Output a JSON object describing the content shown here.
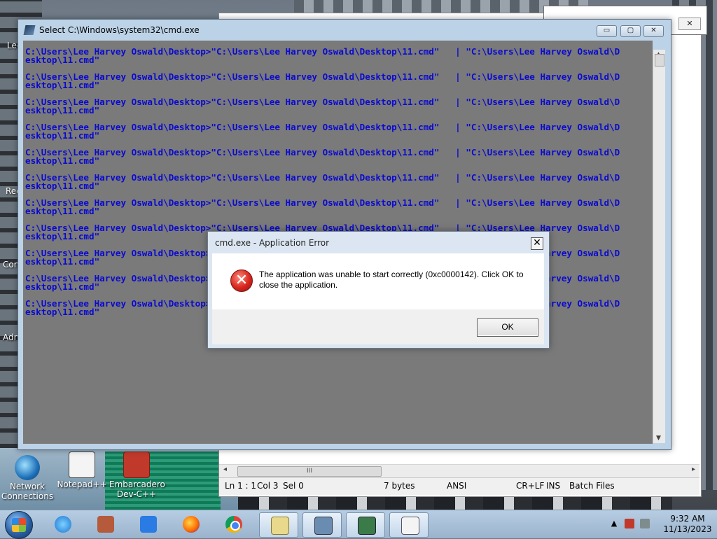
{
  "desktop": {
    "icons": [
      {
        "label_line1": "Network",
        "label_line2": "Connections"
      },
      {
        "label_line1": "Notepad++",
        "label_line2": ""
      },
      {
        "label_line1": "Embarcadero",
        "label_line2": "Dev-C++"
      }
    ],
    "edge_labels": [
      "Lee",
      "Rec",
      "Con",
      "Adn"
    ]
  },
  "cmd_window": {
    "title": "Select C:\\Windows\\system32\\cmd.exe",
    "buttons": {
      "minimize": "▭",
      "maximize": "▢",
      "close": "✕"
    },
    "lines": [
      "C:\\Users\\Lee Harvey Oswald\\Desktop>\"C:\\Users\\Lee Harvey Oswald\\Desktop\\11.cmd\"   | \"C:\\Users\\Lee Harvey Oswald\\D\nesktop\\11.cmd\"",
      "C:\\Users\\Lee Harvey Oswald\\Desktop>\"C:\\Users\\Lee Harvey Oswald\\Desktop\\11.cmd\"   | \"C:\\Users\\Lee Harvey Oswald\\D\nesktop\\11.cmd\"",
      "C:\\Users\\Lee Harvey Oswald\\Desktop>\"C:\\Users\\Lee Harvey Oswald\\Desktop\\11.cmd\"   | \"C:\\Users\\Lee Harvey Oswald\\D\nesktop\\11.cmd\"",
      "C:\\Users\\Lee Harvey Oswald\\Desktop>\"C:\\Users\\Lee Harvey Oswald\\Desktop\\11.cmd\"   | \"C:\\Users\\Lee Harvey Oswald\\D\nesktop\\11.cmd\"",
      "C:\\Users\\Lee Harvey Oswald\\Desktop>\"C:\\Users\\Lee Harvey Oswald\\Desktop\\11.cmd\"   | \"C:\\Users\\Lee Harvey Oswald\\D\nesktop\\11.cmd\"",
      "C:\\Users\\Lee Harvey Oswald\\Desktop>\"C:\\Users\\Lee Harvey Oswald\\Desktop\\11.cmd\"   | \"C:\\Users\\Lee Harvey Oswald\\D\nesktop\\11.cmd\"",
      "C:\\Users\\Lee Harvey Oswald\\Desktop>\"C:\\Users\\Lee Harvey Oswald\\Desktop\\11.cmd\"   | \"C:\\Users\\Lee Harvey Oswald\\D\nesktop\\11.cmd\"",
      "C:\\Users\\Lee Harvey Oswald\\Desktop>\"C:\\Users\\Lee Harvey Oswald\\Desktop\\11.cmd\"   | \"C:\\Users\\Lee Harvey Oswald\\D\nesktop\\11.cmd\"",
      "C:\\Users\\Lee Harvey Oswald\\Desktop>\"C:\\Users\\Lee Harvey Oswald\\Desktop\\11.cmd\"   | \"C:\\Users\\Lee Harvey Oswald\\D\nesktop\\11.cmd\"",
      "C:\\Users\\Lee Harvey Oswald\\Desktop>\"C:\\Users\\Lee Harvey Oswald\\Desktop\\11.cmd\"   | \"C:\\Users\\Lee Harvey Oswald\\D\nesktop\\11.cmd\"",
      "C:\\Users\\Lee Harvey Oswald\\Desktop>\"C:\\Users\\Lee Harvey Oswald\\Desktop\\11.cmd\"   | \"C:\\Users\\Lee Harvey Oswald\\D\nesktop\\11.cmd\""
    ],
    "text_color": "#0a0ad0",
    "background_color": "#7a7a7a"
  },
  "error_dialog": {
    "title": "cmd.exe - Application Error",
    "close": "✕",
    "icon": "error-x-icon",
    "message": "The application was unable to start correctly (0xc0000142). Click OK to close the application.",
    "ok_label": "OK"
  },
  "notepadpp": {
    "dialog_close": "✕",
    "scroll_thumb": "III",
    "status": {
      "position": "Ln 1 : 1",
      "col": "Col 3",
      "sel": "Sel 0",
      "size": "7 bytes",
      "encoding": "ANSI",
      "eol": "CR+LF",
      "mode": "INS",
      "language": "Batch Files"
    }
  },
  "taskbar": {
    "apps": [
      "internet-explorer",
      "store",
      "music",
      "firefox",
      "chrome",
      "notepad",
      "cmd",
      "cmd",
      "cmd"
    ],
    "clock": {
      "time": "9:32 AM",
      "date": "11/13/2023"
    },
    "tray_arrow": "▲"
  }
}
